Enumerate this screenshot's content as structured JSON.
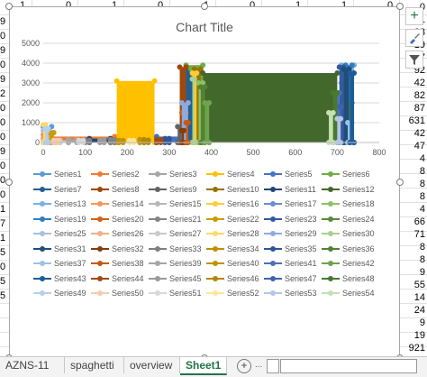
{
  "colors": {
    "accent": "#217346",
    "plot_bg": "#ffffff",
    "axis_text": "#595959"
  },
  "sheet": {
    "top_row_values": [
      "1",
      "0",
      "1",
      "0",
      "1",
      "0",
      "1",
      "1",
      "0"
    ],
    "left_col_values": [
      "9",
      "0",
      "9",
      "0",
      "9",
      "2",
      "0",
      "0",
      "0",
      "9",
      "0",
      "0",
      "0",
      "1",
      "7",
      "1",
      "5",
      "0",
      "5",
      "5"
    ],
    "right_col_values": [
      "0",
      "1",
      "33",
      "19",
      "77",
      "92",
      "42",
      "82",
      "87",
      "631",
      "42",
      "47",
      "4",
      "8",
      "8",
      "8",
      "4",
      "66",
      "71",
      "8",
      "8",
      "9",
      "55",
      "14",
      "24",
      "9",
      "19",
      "921"
    ]
  },
  "chart_tools": {
    "add_icon": "plus-icon",
    "style_icon": "brush-icon",
    "filter_icon": "filter-icon"
  },
  "chart": {
    "title": "Chart Title"
  },
  "chart_data": {
    "type": "area",
    "title": "Chart Title",
    "xlabel": "",
    "ylabel": "",
    "xlim": [
      0,
      800
    ],
    "ylim": [
      0,
      5000
    ],
    "x_ticks": [
      "0",
      "100",
      "200",
      "300",
      "400",
      "500",
      "600",
      "700",
      "800"
    ],
    "y_ticks": [
      "0",
      "1000",
      "2000",
      "3000",
      "4000",
      "5000"
    ],
    "grid": true,
    "legend_position": "bottom",
    "series": [
      {
        "name": "Series1",
        "color": "#5b9bd5",
        "x0": 0,
        "x1": 20,
        "value": 800
      },
      {
        "name": "Series2",
        "color": "#ed7d31",
        "x0": 20,
        "x1": 170,
        "value": 300
      },
      {
        "name": "Series3",
        "color": "#a5a5a5",
        "x0": 0,
        "x1": 20,
        "value": 200
      },
      {
        "name": "Series4",
        "color": "#ffc000",
        "x0": 175,
        "x1": 265,
        "value": 3100
      },
      {
        "name": "Series5",
        "color": "#4472c4",
        "x0": 270,
        "x1": 330,
        "value": 300
      },
      {
        "name": "Series6",
        "color": "#70ad47",
        "x0": 340,
        "x1": 380,
        "value": 3900
      },
      {
        "name": "Series7",
        "color": "#255e91",
        "x0": 340,
        "x1": 370,
        "value": 3600
      },
      {
        "name": "Series8",
        "color": "#9e480e",
        "x0": 325,
        "x1": 340,
        "value": 3800
      },
      {
        "name": "Series9",
        "color": "#636363",
        "x0": 320,
        "x1": 330,
        "value": 800
      },
      {
        "name": "Series10",
        "color": "#997300",
        "x0": 360,
        "x1": 375,
        "value": 3700
      },
      {
        "name": "Series11",
        "color": "#264478",
        "x0": 110,
        "x1": 160,
        "value": 200
      },
      {
        "name": "Series12",
        "color": "#43682b",
        "x0": 380,
        "x1": 700,
        "value": 3500
      },
      {
        "name": "Series13",
        "color": "#7cafdd",
        "x0": 710,
        "x1": 740,
        "value": 3900
      },
      {
        "name": "Series14",
        "color": "#f1975a",
        "x0": 0,
        "x1": 10,
        "value": 400
      },
      {
        "name": "Series15",
        "color": "#b7b7b7",
        "x0": 10,
        "x1": 20,
        "value": 300
      },
      {
        "name": "Series16",
        "color": "#ffcd33",
        "x0": 355,
        "x1": 365,
        "value": 3500
      },
      {
        "name": "Series17",
        "color": "#698ed0",
        "x0": 710,
        "x1": 720,
        "value": 3000
      },
      {
        "name": "Series18",
        "color": "#8cc168",
        "x0": 370,
        "x1": 380,
        "value": 3000
      },
      {
        "name": "Series19",
        "color": "#327dc2",
        "x0": 720,
        "x1": 735,
        "value": 3900
      },
      {
        "name": "Series20",
        "color": "#d26012",
        "x0": 330,
        "x1": 340,
        "value": 1500
      },
      {
        "name": "Series21",
        "color": "#848484",
        "x0": 160,
        "x1": 170,
        "value": 150
      },
      {
        "name": "Series22",
        "color": "#cc9a00",
        "x0": 15,
        "x1": 25,
        "value": 500
      },
      {
        "name": "Series23",
        "color": "#335aa1",
        "x0": 705,
        "x1": 715,
        "value": 3800
      },
      {
        "name": "Series24",
        "color": "#5a8a39",
        "x0": 720,
        "x1": 735,
        "value": 2000
      },
      {
        "name": "Series25",
        "color": "#a2c3e5",
        "x0": 0,
        "x1": 10,
        "value": 600
      },
      {
        "name": "Series26",
        "color": "#f4b183",
        "x0": 0,
        "x1": 30,
        "value": 100
      },
      {
        "name": "Series27",
        "color": "#c9c9c9",
        "x0": 40,
        "x1": 60,
        "value": 100
      },
      {
        "name": "Series28",
        "color": "#ffd966",
        "x0": 0,
        "x1": 5,
        "value": 900
      },
      {
        "name": "Series29",
        "color": "#8faadc",
        "x0": 330,
        "x1": 345,
        "value": 2000
      },
      {
        "name": "Series30",
        "color": "#a9d18e",
        "x0": 355,
        "x1": 360,
        "value": 3200
      },
      {
        "name": "Series31",
        "color": "#1f4e79",
        "x0": 715,
        "x1": 728,
        "value": 3700
      },
      {
        "name": "Series32",
        "color": "#843c0c",
        "x0": 330,
        "x1": 335,
        "value": 600
      },
      {
        "name": "Series33",
        "color": "#7f7f7f",
        "x0": 100,
        "x1": 110,
        "value": 100
      },
      {
        "name": "Series34",
        "color": "#bf9000",
        "x0": 180,
        "x1": 190,
        "value": 100
      },
      {
        "name": "Series35",
        "color": "#2f5597",
        "x0": 290,
        "x1": 300,
        "value": 200
      },
      {
        "name": "Series36",
        "color": "#548235",
        "x0": 375,
        "x1": 385,
        "value": 2800
      },
      {
        "name": "Series37",
        "color": "#9dc3e6",
        "x0": 725,
        "x1": 735,
        "value": 1000
      },
      {
        "name": "Series38",
        "color": "#c55a11",
        "x0": 340,
        "x1": 345,
        "value": 1000
      },
      {
        "name": "Series39",
        "color": "#a6a6a6",
        "x0": 60,
        "x1": 80,
        "value": 150
      },
      {
        "name": "Series40",
        "color": "#c09200",
        "x0": 230,
        "x1": 240,
        "value": 150
      },
      {
        "name": "Series41",
        "color": "#4d6fb8",
        "x0": 700,
        "x1": 705,
        "value": 2500
      },
      {
        "name": "Series42",
        "color": "#6fa24c",
        "x0": 385,
        "x1": 395,
        "value": 2000
      },
      {
        "name": "Series43",
        "color": "#1c5c99",
        "x0": 730,
        "x1": 740,
        "value": 3500
      },
      {
        "name": "Series44",
        "color": "#a04b13",
        "x0": 270,
        "x1": 280,
        "value": 150
      },
      {
        "name": "Series45",
        "color": "#9a9a9a",
        "x0": 135,
        "x1": 145,
        "value": 120
      },
      {
        "name": "Series46",
        "color": "#b38600",
        "x0": 240,
        "x1": 250,
        "value": 120
      },
      {
        "name": "Series47",
        "color": "#3f62ae",
        "x0": 705,
        "x1": 710,
        "value": 1800
      },
      {
        "name": "Series48",
        "color": "#477a2d",
        "x0": 690,
        "x1": 700,
        "value": 2500
      },
      {
        "name": "Series49",
        "color": "#b4d0ec",
        "x0": 5,
        "x1": 12,
        "value": 700
      },
      {
        "name": "Series50",
        "color": "#f8cbad",
        "x0": 25,
        "x1": 35,
        "value": 100
      },
      {
        "name": "Series51",
        "color": "#d9d9d9",
        "x0": 85,
        "x1": 95,
        "value": 100
      },
      {
        "name": "Series52",
        "color": "#ffe699",
        "x0": 205,
        "x1": 215,
        "value": 100
      },
      {
        "name": "Series53",
        "color": "#b4c7e7",
        "x0": 700,
        "x1": 708,
        "value": 1200
      },
      {
        "name": "Series54",
        "color": "#c5e0b4",
        "x0": 680,
        "x1": 690,
        "value": 1500
      }
    ]
  },
  "tabs": {
    "items": [
      "AZNS-11",
      "spaghetti",
      "overview",
      "Sheet1"
    ],
    "active": "Sheet1",
    "add_icon": "plus-icon",
    "more": "..."
  }
}
